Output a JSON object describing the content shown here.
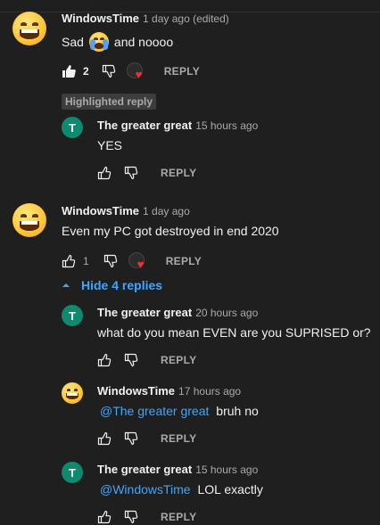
{
  "comments": [
    {
      "author": "WindowsTime",
      "time": "1 day ago (edited)",
      "text_before": "Sad",
      "emoji": "crying-face",
      "text_after": "and noooo",
      "likes": "2",
      "reply_label": "REPLY"
    },
    {
      "badge": "Highlighted reply",
      "author": "The greater great",
      "avatar_letter": "T",
      "time": "15 hours ago",
      "text": "YES",
      "reply_label": "REPLY"
    },
    {
      "author": "WindowsTime",
      "time": "1 day ago",
      "text": "Even my PC got destroyed in end 2020",
      "likes": "1",
      "reply_label": "REPLY",
      "toggle_label": "Hide 4 replies"
    },
    {
      "author": "The greater great",
      "avatar_letter": "T",
      "time": "20 hours ago",
      "text": "what do you mean EVEN are you SUPRISED or?",
      "reply_label": "REPLY"
    },
    {
      "author": "WindowsTime",
      "time": "17 hours ago",
      "mention": "@The greater great",
      "text": "bruh no",
      "reply_label": "REPLY"
    },
    {
      "author": "The greater great",
      "avatar_letter": "T",
      "time": "15 hours ago",
      "mention": "@WindowsTime",
      "text": "LOL exactly",
      "reply_label": "REPLY"
    }
  ],
  "colors": {
    "background": "#1f1f1f",
    "link": "#3ea6ff",
    "avatar_green": "#0f8a6e",
    "heart": "#ff2d2d"
  }
}
